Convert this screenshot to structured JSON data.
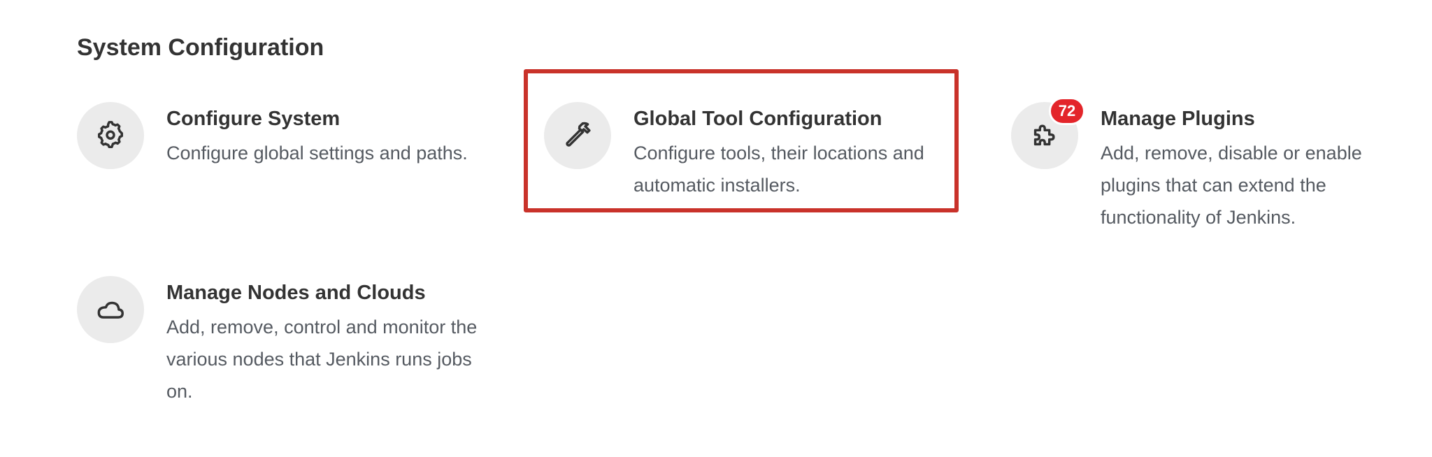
{
  "section": {
    "title": "System Configuration"
  },
  "items": [
    {
      "title": "Configure System",
      "description": "Configure global settings and paths.",
      "icon": "gear-icon"
    },
    {
      "title": "Global Tool Configuration",
      "description": "Configure tools, their locations and automatic installers.",
      "icon": "hammer-icon",
      "highlighted": true
    },
    {
      "title": "Manage Plugins",
      "description": "Add, remove, disable or enable plugins that can extend the functionality of Jenkins.",
      "icon": "puzzle-icon",
      "badge": "72"
    },
    {
      "title": "Manage Nodes and Clouds",
      "description": "Add, remove, control and monitor the various nodes that Jenkins runs jobs on.",
      "icon": "cloud-icon"
    }
  ],
  "colors": {
    "highlight_border": "#c9322a",
    "badge_background": "#e3252a",
    "icon_circle_background": "#ebebeb"
  }
}
